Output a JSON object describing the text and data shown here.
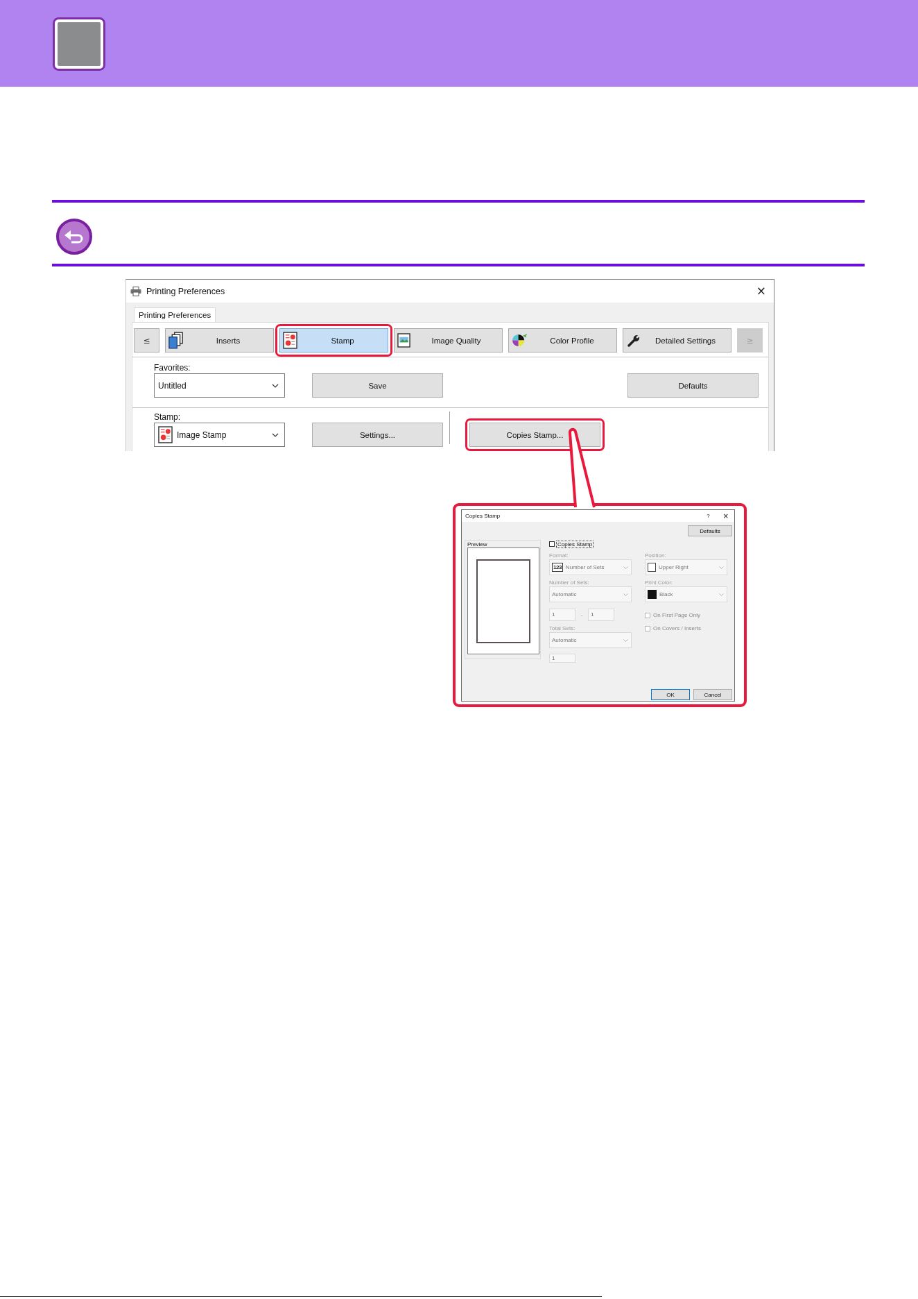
{
  "printing_preferences": {
    "window": {
      "title": "Printing Preferences",
      "close": "×"
    },
    "tabs": [
      {
        "label": "Printing Preferences",
        "selected": true
      }
    ],
    "category_bar": [
      {
        "kind": "arrow",
        "label": "≤",
        "disabled": false
      },
      {
        "kind": "category",
        "label": "Inserts",
        "selected": false,
        "highlighted": false
      },
      {
        "kind": "category",
        "label": "Stamp",
        "selected": true,
        "highlighted": true
      },
      {
        "kind": "category",
        "label": "Image Quality",
        "selected": false,
        "highlighted": false
      },
      {
        "kind": "category",
        "label": "Color Profile",
        "selected": false,
        "highlighted": false
      },
      {
        "kind": "category",
        "label": "Detailed Settings",
        "selected": false,
        "highlighted": false
      },
      {
        "kind": "arrow",
        "label": "≥",
        "disabled": true
      }
    ],
    "favorites": {
      "label": "Favorites:",
      "value": "Untitled",
      "buttons": [
        {
          "label": "Save",
          "highlighted": false
        },
        {
          "label": "Defaults",
          "highlighted": false
        }
      ]
    },
    "stamp": {
      "label": "Stamp:",
      "value": "Image Stamp",
      "buttons": [
        {
          "label": "Settings...",
          "highlighted": false
        },
        {
          "label": "Copies Stamp...",
          "highlighted": true
        }
      ]
    }
  },
  "copies_stamp_dialog": {
    "window": {
      "title": "Copies Stamp",
      "help": "?",
      "close": "×"
    },
    "defaults_button": "Defaults",
    "preview": {
      "label": "Preview"
    },
    "enable": {
      "label": "Copies Stamp",
      "checked": false,
      "focused": true
    },
    "left_column": [
      {
        "kind": "dropdown",
        "label": "Format:",
        "badge": "123",
        "value": "Number of Sets",
        "disabled": true
      },
      {
        "kind": "dropdown",
        "label": "Number of Sets:",
        "value": "Automatic",
        "disabled": true
      },
      {
        "kind": "range",
        "from": "1",
        "separator": "-",
        "to": "1",
        "disabled": true
      },
      {
        "kind": "dropdown",
        "label": "Total Sets:",
        "value": "Automatic",
        "disabled": true
      },
      {
        "kind": "input",
        "value": "1",
        "disabled": true
      }
    ],
    "right_column": [
      {
        "kind": "dropdown",
        "label": "Position:",
        "value": "Upper Right",
        "disabled": true
      },
      {
        "kind": "dropdown",
        "label": "Print Color:",
        "value": "Black",
        "disabled": true
      },
      {
        "kind": "checkbox",
        "label": "On First Page Only",
        "checked": false,
        "disabled": true
      },
      {
        "kind": "checkbox",
        "label": "On Covers / Inserts",
        "checked": false,
        "disabled": true
      }
    ],
    "buttons": [
      {
        "label": "OK",
        "default": true
      },
      {
        "label": "Cancel",
        "default": false
      }
    ]
  }
}
